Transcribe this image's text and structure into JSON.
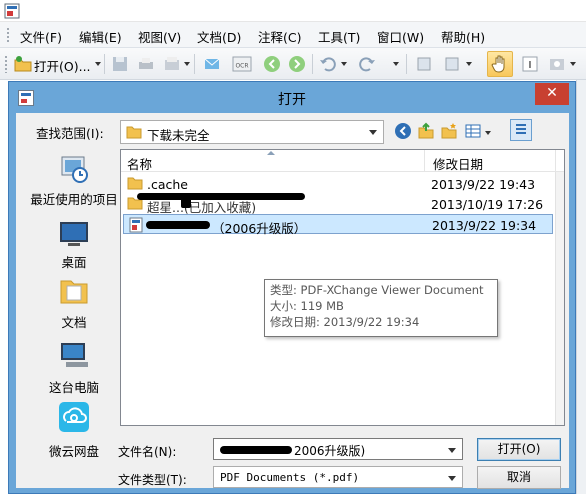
{
  "app": {
    "menu": [
      "文件(F)",
      "编辑(E)",
      "视图(V)",
      "文档(D)",
      "注释(C)",
      "工具(T)",
      "窗口(W)",
      "帮助(H)"
    ],
    "toolbar": {
      "open_label": "打开(O)..."
    }
  },
  "dialog": {
    "title": "打开",
    "close_glyph": "✕",
    "look_in_label": "查找范围(I):",
    "look_in_value": "下载未完全",
    "places": [
      {
        "label": "最近使用的项目",
        "icon": "recent-items-icon"
      },
      {
        "label": "桌面",
        "icon": "desktop-icon"
      },
      {
        "label": "文档",
        "icon": "documents-icon"
      },
      {
        "label": "这台电脑",
        "icon": "this-pc-icon"
      },
      {
        "label": "微云网盘",
        "icon": "weiyun-cloud-icon"
      }
    ],
    "columns": {
      "name": "名称",
      "date": "修改日期"
    },
    "files": [
      {
        "name": ".cache",
        "date": "2013/9/22 19:43",
        "type": "folder",
        "selected": false
      },
      {
        "name": "超星...(已加入收藏)",
        "date": "2013/10/19 17:26",
        "type": "folder",
        "selected": false
      },
      {
        "name": "（2006升级版）",
        "date": "2013/9/22 19:34",
        "type": "pdf",
        "selected": true
      }
    ],
    "tooltip": {
      "type": "类型: PDF-XChange Viewer Document",
      "size": "大小: 119 MB",
      "modified": "修改日期: 2013/9/22 19:34"
    },
    "filename_label": "文件名(N):",
    "filename_value": "2006升级版)",
    "filetype_label": "文件类型(T):",
    "filetype_value": "PDF Documents (*.pdf)",
    "open_button": "打开(O)",
    "cancel_button": "取消"
  },
  "colors": {
    "dialog_frame": "#6aa6d8",
    "close": "#c84031",
    "selection": "#cce8ff"
  }
}
